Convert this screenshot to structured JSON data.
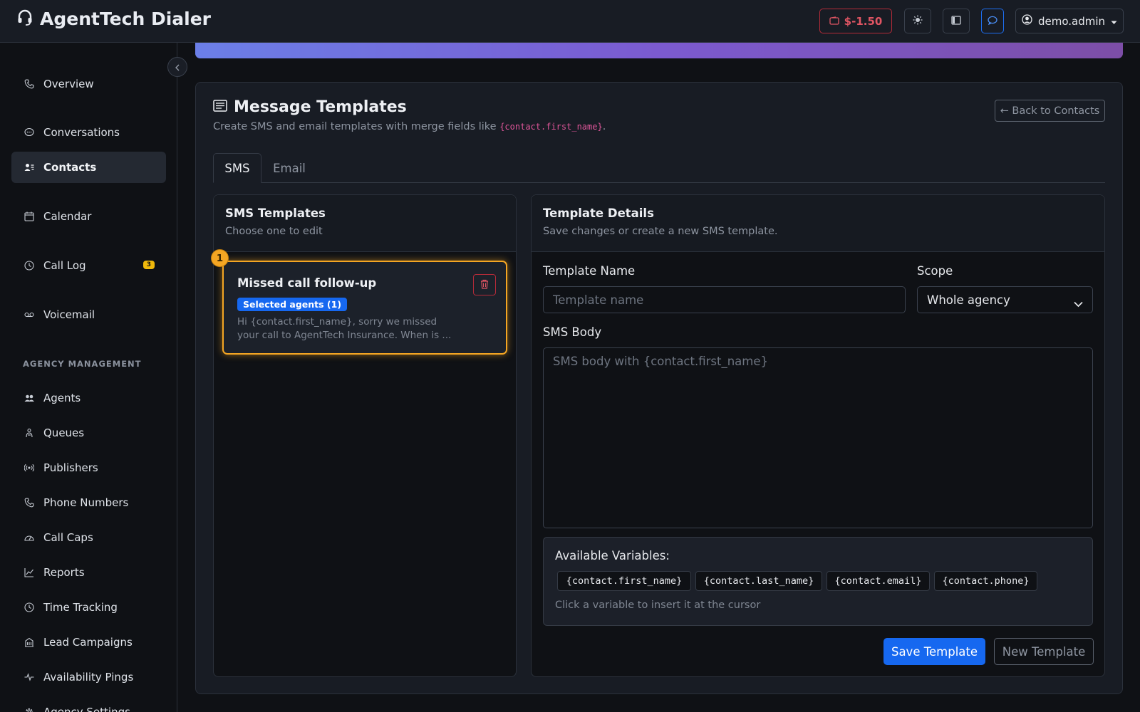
{
  "app": {
    "title": "AgentTech Dialer",
    "balance": "$-1.50",
    "user": "demo.admin"
  },
  "sidebar": {
    "items": [
      {
        "label": "Overview",
        "icon": "phone-icon"
      },
      {
        "label": "Conversations",
        "icon": "chat-icon"
      },
      {
        "label": "Contacts",
        "icon": "contacts-icon",
        "active": true
      },
      {
        "label": "Calendar",
        "icon": "calendar-icon"
      },
      {
        "label": "Call Log",
        "icon": "clock-icon",
        "badge": "3"
      },
      {
        "label": "Voicemail",
        "icon": "voicemail-icon"
      }
    ],
    "section_label": "AGENCY MANAGEMENT",
    "mgmt_items": [
      {
        "label": "Agents",
        "icon": "people-icon"
      },
      {
        "label": "Queues",
        "icon": "queue-icon"
      },
      {
        "label": "Publishers",
        "icon": "broadcast-icon"
      },
      {
        "label": "Phone Numbers",
        "icon": "phone-icon"
      },
      {
        "label": "Call Caps",
        "icon": "gauge-icon"
      },
      {
        "label": "Reports",
        "icon": "chart-icon"
      },
      {
        "label": "Time Tracking",
        "icon": "clock-icon"
      },
      {
        "label": "Lead Campaigns",
        "icon": "building-icon"
      },
      {
        "label": "Availability Pings",
        "icon": "pulse-icon"
      },
      {
        "label": "Agency Settings",
        "icon": "gear-icon"
      }
    ]
  },
  "page": {
    "title": "Message Templates",
    "subtitle_prefix": "Create SMS and email templates with merge fields like ",
    "subtitle_code": "{contact.first_name}",
    "subtitle_suffix": ".",
    "back_button": "← Back to Contacts"
  },
  "tabs": [
    {
      "label": "SMS",
      "active": true
    },
    {
      "label": "Email",
      "active": false
    }
  ],
  "template_list": {
    "title": "SMS Templates",
    "subtitle": "Choose one to edit",
    "items": [
      {
        "number": "1",
        "name": "Missed call follow-up",
        "badge": "Selected agents (1)",
        "preview": "Hi {contact.first_name}, sorry we missed your call to AgentTech Insurance. When is ..."
      }
    ]
  },
  "details": {
    "title": "Template Details",
    "subtitle": "Save changes or create a new SMS template.",
    "name_label": "Template Name",
    "name_placeholder": "Template name",
    "name_value": "",
    "scope_label": "Scope",
    "scope_value": "Whole agency",
    "body_label": "SMS Body",
    "body_placeholder": "SMS body with {contact.first_name}",
    "body_value": "",
    "vars_title": "Available Variables:",
    "variables": [
      "{contact.first_name}",
      "{contact.last_name}",
      "{contact.email}",
      "{contact.phone}"
    ],
    "vars_hint": "Click a variable to insert it at the cursor",
    "save_button": "Save Template",
    "new_button": "New Template"
  },
  "colors": {
    "accent": "#1668f0",
    "highlight": "#f5a623",
    "danger": "#b42b39",
    "badge": "#f0b90b"
  }
}
